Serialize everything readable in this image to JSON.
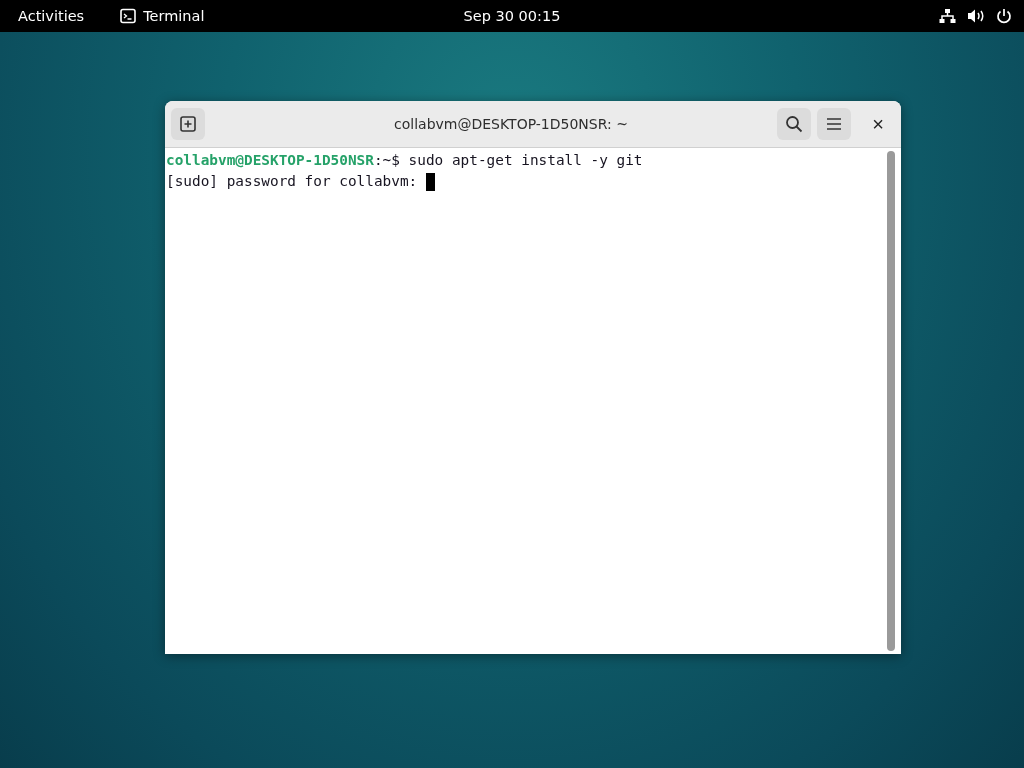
{
  "top_bar": {
    "activities": "Activities",
    "app": "Terminal",
    "clock": "Sep 30  00:15"
  },
  "window": {
    "title": "collabvm@DESKTOP-1D50NSR: ~",
    "close": "×"
  },
  "terminal": {
    "lines": [
      {
        "kind": "prompt",
        "user": "collabvm@DESKTOP-1D50NSR",
        "path": ":~$",
        "command": "sudo apt-get install -y git"
      },
      {
        "kind": "output",
        "text": "[sudo] password for collabvm:",
        "cursor": true
      }
    ]
  }
}
